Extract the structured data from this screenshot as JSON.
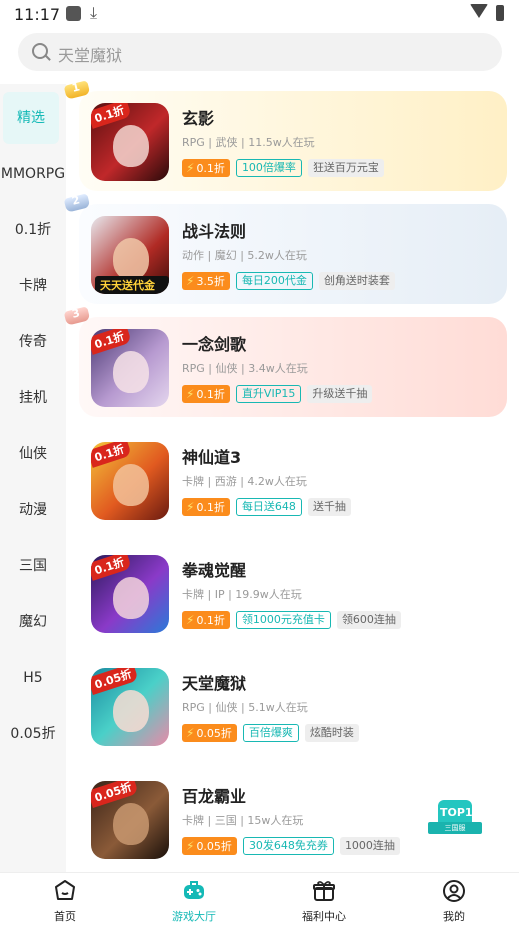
{
  "status": {
    "time": "11:17"
  },
  "search": {
    "placeholder": "天堂魔狱"
  },
  "sidebar": {
    "items": [
      "精选",
      "MMORPG",
      "0.1折",
      "卡牌",
      "传奇",
      "挂机",
      "仙侠",
      "动漫",
      "三国",
      "魔幻",
      "H5",
      "0.05折"
    ],
    "active": 0
  },
  "games": [
    {
      "rank": "1",
      "name": "玄影",
      "meta": "RPG | 武侠 | 11.5w人在玩",
      "thumb_badge": "0.1折",
      "discount": "0.1折",
      "main_tag": "100倍爆率",
      "sub_tag": "狂送百万元宝"
    },
    {
      "rank": "2",
      "name": "战斗法则",
      "meta": "动作 | 魔幻 | 5.2w人在玩",
      "thumb_badge": "天天送代金券",
      "discount": "3.5折",
      "main_tag": "每日200代金",
      "sub_tag": "创角送时装套"
    },
    {
      "rank": "3",
      "name": "一念剑歌",
      "meta": "RPG | 仙侠 | 3.4w人在玩",
      "thumb_badge": "0.1折",
      "discount": "0.1折",
      "main_tag": "直升VIP15",
      "sub_tag": "升级送千抽"
    },
    {
      "rank": "",
      "name": "神仙道3",
      "meta": "卡牌 | 西游 | 4.2w人在玩",
      "thumb_badge": "0.1折",
      "discount": "0.1折",
      "main_tag": "每日送648",
      "sub_tag": "送千抽"
    },
    {
      "rank": "",
      "name": "拳魂觉醒",
      "meta": "卡牌 | IP | 19.9w人在玩",
      "thumb_badge": "0.1折",
      "discount": "0.1折",
      "main_tag": "领1000元充值卡",
      "sub_tag": "领600连抽"
    },
    {
      "rank": "",
      "name": "天堂魔狱",
      "meta": "RPG | 仙侠 | 5.1w人在玩",
      "thumb_badge": "0.05折",
      "discount": "0.05折",
      "main_tag": "百倍爆爽",
      "sub_tag": "炫酷时装"
    },
    {
      "rank": "",
      "name": "百龙霸业",
      "meta": "卡牌 | 三国 | 15w人在玩",
      "thumb_badge": "0.05折",
      "discount": "0.05折",
      "main_tag": "30发648免充券",
      "sub_tag": "1000连抽"
    }
  ],
  "floating_badge": {
    "label": "TOP1",
    "sub": "三国服"
  },
  "tabbar": {
    "items": [
      "首页",
      "游戏大厅",
      "福利中心",
      "我的"
    ],
    "active": 1
  },
  "colors": {
    "accent": "#14b9b6",
    "discount": "#fb8c1c",
    "thumb_badge": "#d9261c"
  }
}
